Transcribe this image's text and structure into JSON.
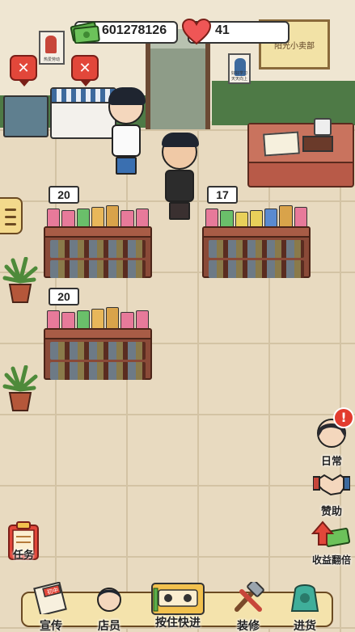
{
  "hud": {
    "money": "601278126",
    "hearts": "41"
  },
  "shop_sign": "阳光小卖部",
  "posters": [
    "热爱劳动",
    "好好学习天天向上"
  ],
  "shelves": [
    {
      "price": "20"
    },
    {
      "price": "17"
    },
    {
      "price": "20"
    }
  ],
  "side_buttons": {
    "daily": "日常",
    "daily_alert": "!",
    "sponsor": "赞助",
    "double_income": "收益翻倍",
    "task": "任务"
  },
  "bottom_nav": {
    "promote": "宣传",
    "staff": "店员",
    "fast_forward": "按住快进",
    "decorate": "装修",
    "restock": "进货",
    "book_label": "初中"
  },
  "colors": {
    "accent_red": "#e2473a",
    "wall_green": "#4e7a46",
    "floor": "#e8dac0",
    "bar_bg": "#f4e3ac"
  }
}
